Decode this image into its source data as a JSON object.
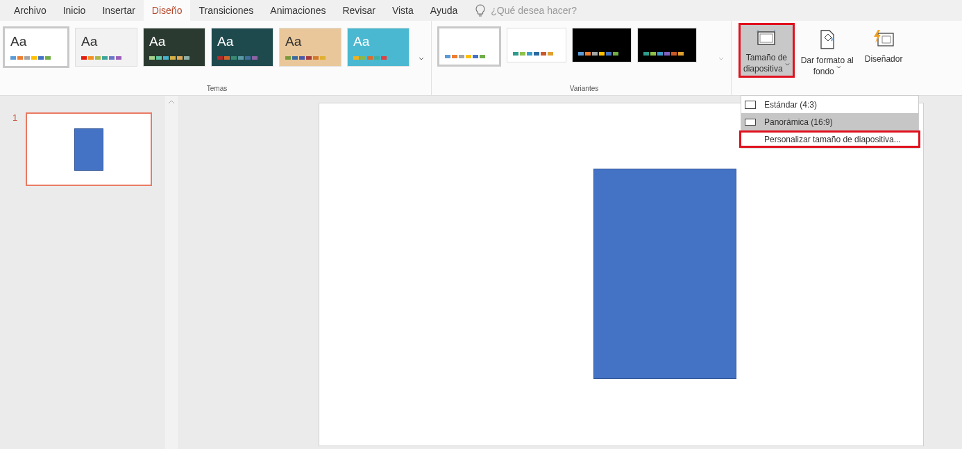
{
  "tabs": [
    {
      "label": "Archivo",
      "selected": false
    },
    {
      "label": "Inicio",
      "selected": false
    },
    {
      "label": "Insertar",
      "selected": false
    },
    {
      "label": "Diseño",
      "selected": true
    },
    {
      "label": "Transiciones",
      "selected": false
    },
    {
      "label": "Animaciones",
      "selected": false
    },
    {
      "label": "Revisar",
      "selected": false
    },
    {
      "label": "Vista",
      "selected": false
    },
    {
      "label": "Ayuda",
      "selected": false
    }
  ],
  "search": {
    "placeholder": "¿Qué desea hacer?"
  },
  "themes": {
    "label": "Temas",
    "items": [
      {
        "kind": "office",
        "sample": "Aa",
        "selected": true
      },
      {
        "kind": "red",
        "sample": "Aa",
        "selected": false
      },
      {
        "kind": "green",
        "sample": "Aa",
        "selected": false
      },
      {
        "kind": "teal",
        "sample": "Aa",
        "selected": false
      },
      {
        "kind": "wood",
        "sample": "Aa",
        "selected": false
      },
      {
        "kind": "cyan",
        "sample": "Aa",
        "selected": false
      }
    ]
  },
  "variants": {
    "label": "Variantes",
    "items": [
      {
        "kind": "light",
        "selected": true
      },
      {
        "kind": "light2",
        "selected": false
      },
      {
        "kind": "dark",
        "selected": false
      },
      {
        "kind": "dark2",
        "selected": false
      }
    ]
  },
  "buttons": [
    {
      "kind": "slide-size",
      "label_1": "Tamaño de",
      "label_2": "diapositiva",
      "highlighted": true,
      "pressed": true
    },
    {
      "kind": "format-background",
      "label_1": "Dar formato al",
      "label_2": "fondo",
      "highlighted": false,
      "pressed": false
    },
    {
      "kind": "designer",
      "label_1": "Diseñador",
      "highlighted": false,
      "pressed": false
    }
  ],
  "menu": [
    {
      "kind": "standard",
      "label": "Estándar (4:3)",
      "selected": false,
      "highlighted": false
    },
    {
      "kind": "wide",
      "label": "Panorámica (16:9)",
      "selected": true,
      "highlighted": false
    },
    {
      "kind": "custom",
      "label": "Personalizar tamaño de diapositiva...",
      "selected": false,
      "highlighted": true
    }
  ],
  "slides": [
    {
      "number": "1",
      "selected": true
    }
  ]
}
